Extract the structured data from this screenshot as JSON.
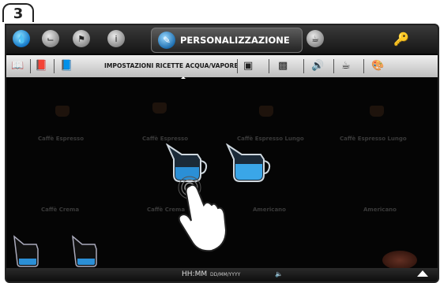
{
  "step_number": "3",
  "topbar": {
    "active_tab_label": "PERSONALIZZAZIONE",
    "icons": [
      "water-drop-icon",
      "clock-icon",
      "flag-icon",
      "info-icon",
      "person-cup-icon",
      "key-icon"
    ]
  },
  "subbar": {
    "label": "IMPOSTAZIONI RICETTE ACQUA/VAPORE",
    "icons": [
      "book-icon",
      "book-icon",
      "book-icon",
      "image-icon",
      "frame-icon",
      "speaker-icon",
      "cup-icon",
      "palette-icon"
    ]
  },
  "content": {
    "ghost_labels": [
      "Caffè Espresso",
      "Caffè Espresso",
      "Caffè Espresso Lungo",
      "Caffè Espresso Lungo",
      "Caffè Crema",
      "Caffè Crema",
      "Americano",
      "Americano"
    ]
  },
  "footer": {
    "time": "HH:MM",
    "date": "DD/MM/YYYY"
  }
}
